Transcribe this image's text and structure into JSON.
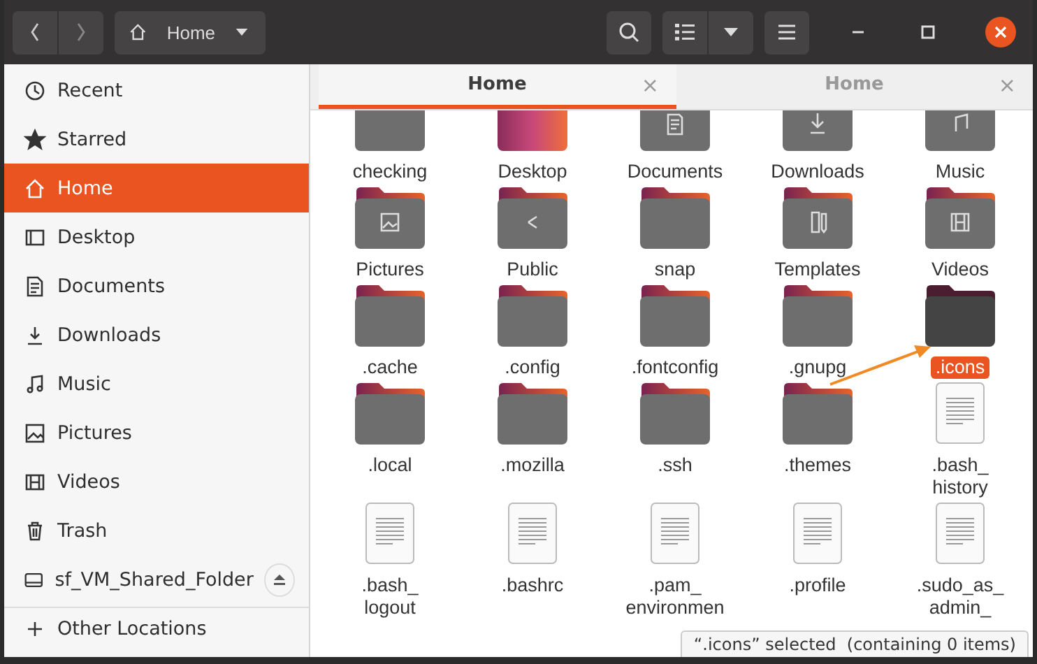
{
  "header": {
    "path_label": "Home"
  },
  "sidebar": {
    "items": [
      {
        "label": "Recent",
        "selected": false
      },
      {
        "label": "Starred",
        "selected": false
      },
      {
        "label": "Home",
        "selected": true
      },
      {
        "label": "Desktop",
        "selected": false
      },
      {
        "label": "Documents",
        "selected": false
      },
      {
        "label": "Downloads",
        "selected": false
      },
      {
        "label": "Music",
        "selected": false
      },
      {
        "label": "Pictures",
        "selected": false
      },
      {
        "label": "Videos",
        "selected": false
      },
      {
        "label": "Trash",
        "selected": false
      },
      {
        "label": "sf_VM_Shared_Folder",
        "selected": false,
        "ejectable": true
      }
    ],
    "other_locations": "Other Locations"
  },
  "tabs": [
    {
      "label": "Home",
      "selected": true,
      "close": "×"
    },
    {
      "label": "Home",
      "selected": false,
      "close": "×"
    }
  ],
  "items": [
    {
      "kind": "folder",
      "label": "checking",
      "selected": false
    },
    {
      "kind": "desktop",
      "label": "Desktop",
      "selected": false
    },
    {
      "kind": "folder",
      "label": "Documents",
      "selected": false
    },
    {
      "kind": "folder",
      "label": "Downloads",
      "selected": false
    },
    {
      "kind": "folder",
      "label": "Music",
      "selected": false
    },
    {
      "kind": "folder",
      "label": "Pictures",
      "selected": false
    },
    {
      "kind": "folder",
      "label": "Public",
      "selected": false
    },
    {
      "kind": "folder",
      "label": "snap",
      "selected": false
    },
    {
      "kind": "folder",
      "label": "Templates",
      "selected": false
    },
    {
      "kind": "folder",
      "label": "Videos",
      "selected": false
    },
    {
      "kind": "folder",
      "label": ".cache",
      "selected": false
    },
    {
      "kind": "folder",
      "label": ".config",
      "selected": false
    },
    {
      "kind": "folder",
      "label": ".fontconfig",
      "selected": false
    },
    {
      "kind": "folder",
      "label": ".gnupg",
      "selected": false
    },
    {
      "kind": "folder",
      "label": ".icons",
      "selected": true
    },
    {
      "kind": "folder",
      "label": ".local",
      "selected": false
    },
    {
      "kind": "folder",
      "label": ".mozilla",
      "selected": false
    },
    {
      "kind": "folder",
      "label": ".ssh",
      "selected": false
    },
    {
      "kind": "folder",
      "label": ".themes",
      "selected": false
    },
    {
      "kind": "file",
      "label": ".bash_history",
      "selected": false
    },
    {
      "kind": "file",
      "label": ".bash_logout",
      "selected": false
    },
    {
      "kind": "file",
      "label": ".bashrc",
      "selected": false
    },
    {
      "kind": "file",
      "label": ".pam_environmen",
      "selected": false
    },
    {
      "kind": "file",
      "label": ".profile",
      "selected": false
    },
    {
      "kind": "file",
      "label": ".sudo_as_admin_",
      "selected": false
    }
  ],
  "status": "“.icons” selected  (containing 0 items)"
}
